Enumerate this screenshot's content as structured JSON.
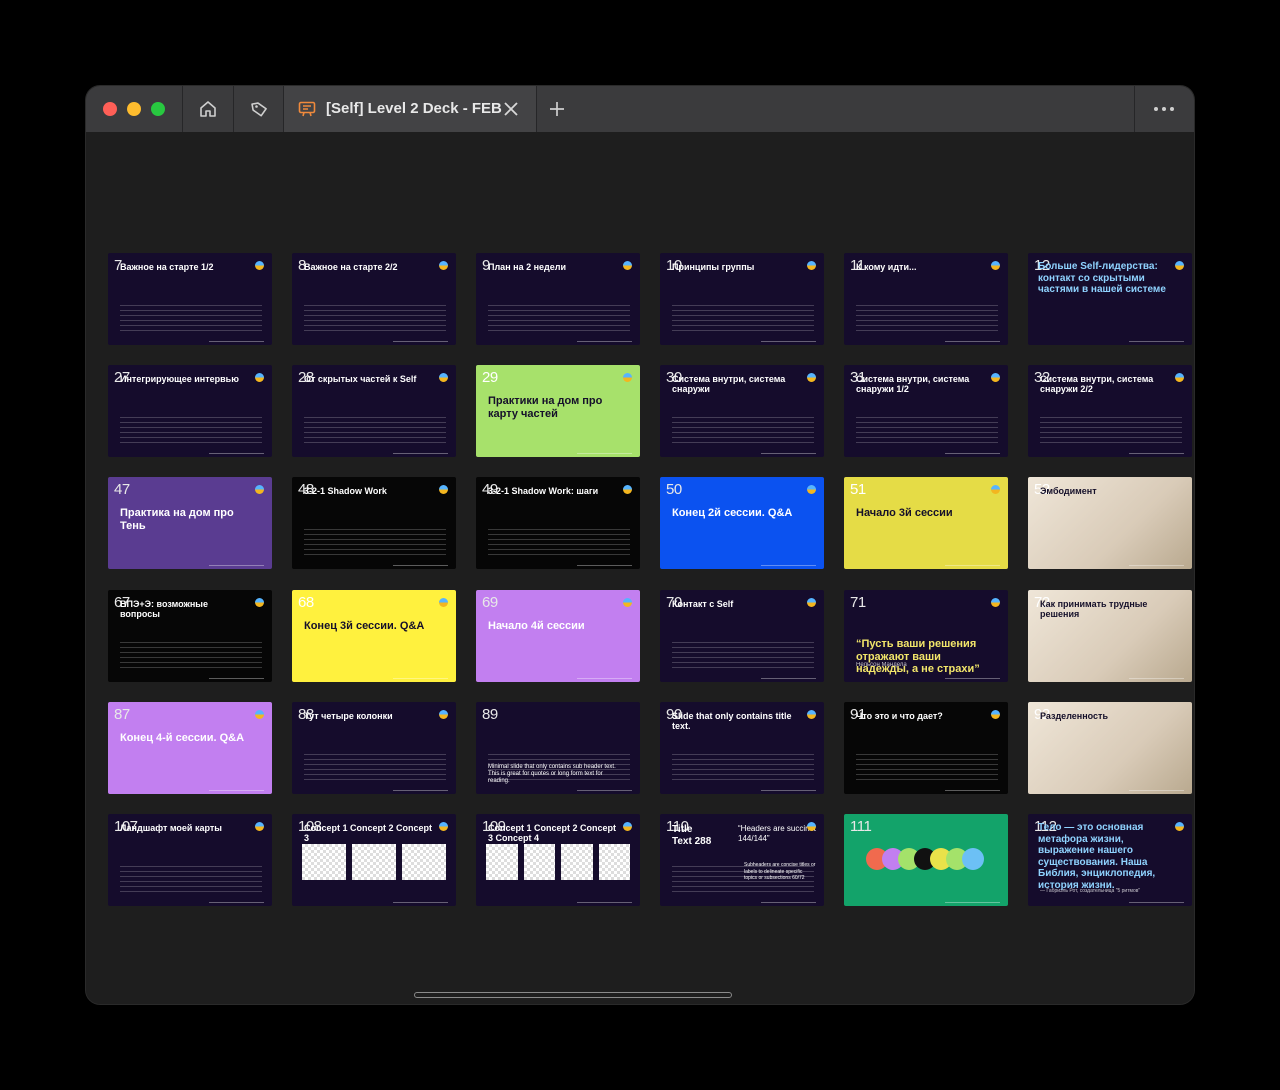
{
  "window": {
    "tab_title": "[Self] Level 2 Deck - FEB",
    "icons": [
      "home-icon",
      "tag-icon",
      "presentation-icon",
      "close-icon",
      "plus-icon",
      "more-icon"
    ]
  },
  "colors": {
    "navy": "#150c2c",
    "black": "#060606",
    "lime": "#a7e16b",
    "blue": "#0b52f0",
    "yellow": "#e5dc46",
    "bright_yellow": "#fff13e",
    "purple": "#c27ff0",
    "violet": "#5a3c91",
    "teal": "#13a36a"
  },
  "slides": [
    {
      "num": "7",
      "title": "Важное на старте 1/2",
      "bg": "navy"
    },
    {
      "num": "8",
      "title": "Важное на старте 2/2",
      "bg": "navy"
    },
    {
      "num": "9",
      "title": "План на 2 недели",
      "bg": "navy"
    },
    {
      "num": "10",
      "title": "Принципы группы",
      "bg": "navy"
    },
    {
      "num": "11",
      "title": "К кому идти...",
      "bg": "navy"
    },
    {
      "num": "12",
      "title": "Больше Self-лидерства: контакт со скрытыми частями в нашей системе",
      "bg": "navy"
    },
    {
      "num": "27",
      "title": "Интегрирующее интервью",
      "bg": "navy"
    },
    {
      "num": "28",
      "title": "От скрытых частей к Self",
      "bg": "navy"
    },
    {
      "num": "29",
      "title": "Практики на дом про карту частей",
      "bg": "lime"
    },
    {
      "num": "30",
      "title": "Система внутри, система снаружи",
      "bg": "navy"
    },
    {
      "num": "31",
      "title": "Система внутри, система снаружи 1/2",
      "bg": "navy"
    },
    {
      "num": "32",
      "title": "Система внутри, система снаружи 2/2",
      "bg": "navy"
    },
    {
      "num": "47",
      "title": "Практика на дом про Тень",
      "bg": "violet"
    },
    {
      "num": "48",
      "title": "3-2-1 Shadow Work",
      "bg": "black"
    },
    {
      "num": "49",
      "title": "3-2-1 Shadow Work: шаги",
      "bg": "black"
    },
    {
      "num": "50",
      "title": "Конец 2й сессии. Q&A",
      "bg": "blue"
    },
    {
      "num": "51",
      "title": "Начало 3й сессии",
      "bg": "yellow"
    },
    {
      "num": "52",
      "title": "Эмбодимент",
      "bg": "photo"
    },
    {
      "num": "67",
      "title": "ВПЭ+Э: возможные вопросы",
      "bg": "black"
    },
    {
      "num": "68",
      "title": "Конец 3й сессии. Q&A",
      "bg": "bright_yellow"
    },
    {
      "num": "69",
      "title": "Начало 4й сессии",
      "bg": "purple"
    },
    {
      "num": "70",
      "title": "Контакт с Self",
      "bg": "navy"
    },
    {
      "num": "71",
      "title": "“Пусть ваши решения отражают ваши надежды, а не страхи”",
      "bg": "navy"
    },
    {
      "num": "72",
      "title": "Как принимать трудные решения",
      "bg": "photo"
    },
    {
      "num": "87",
      "title": "Конец 4-й сессии. Q&A",
      "bg": "purple"
    },
    {
      "num": "88",
      "title": "Тут четыре колонки",
      "bg": "navy"
    },
    {
      "num": "89",
      "title": "Minimal slide that only contains sub header text. This is great for quotes or long form text for reading.",
      "bg": "navy"
    },
    {
      "num": "90",
      "title": "Slide that only contains title text.",
      "bg": "navy"
    },
    {
      "num": "91",
      "title": "Что это и что дает?",
      "bg": "black"
    },
    {
      "num": "92",
      "title": "Разделенность",
      "bg": "photo"
    },
    {
      "num": "107",
      "title": "Ландшафт моей карты",
      "bg": "navy"
    },
    {
      "num": "108",
      "title": "Concept 1  Concept 2  Concept 3",
      "bg": "navy"
    },
    {
      "num": "109",
      "title": "Concept 1  Concept 2  Concept 3  Concept 4",
      "bg": "navy"
    },
    {
      "num": "110",
      "title": "Title Text 288",
      "bg": "navy"
    },
    {
      "num": "111",
      "title": "",
      "bg": "teal"
    },
    {
      "num": "112",
      "title": "Тело — это основная метафора жизни, выражение нашего существования. Наша Библия, энциклопедия, история жизни.",
      "bg": "navy"
    }
  ],
  "extra_text": {
    "quote_71": "Нельсон Мандела",
    "quote_112": "— Габриэль Рот, создательница \"5 ритмов\"",
    "slide_110_quote": "“Headers are succinct 144/144”",
    "slide_110_body": "Subheaders are concise titles or labels to delineate specific topics or subsections 60/72"
  }
}
